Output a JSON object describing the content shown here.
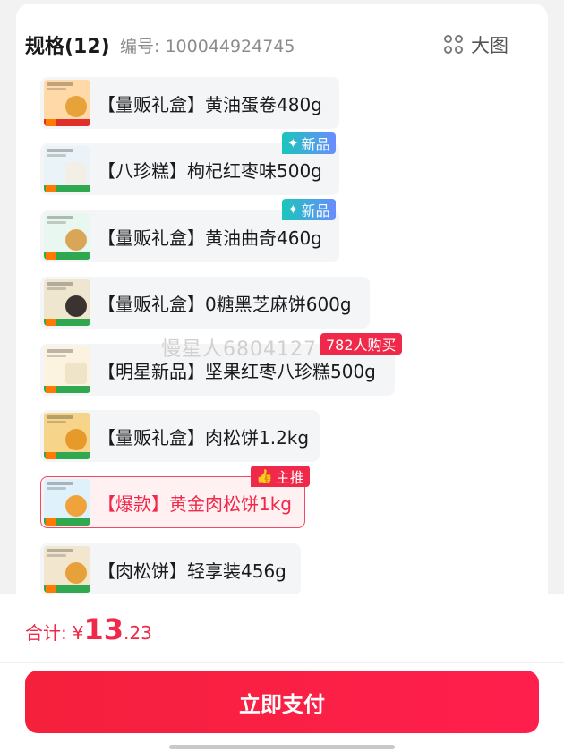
{
  "header": {
    "title": "规格(12)",
    "sku": "编号: 100044924745",
    "big_image_label": "大图"
  },
  "options": [
    {
      "label": "【量贩礼盒】黄油蛋卷480g",
      "selected": false
    },
    {
      "label": "【八珍糕】枸杞红枣味500g",
      "selected": false,
      "tag": "新品"
    },
    {
      "label": "【量贩礼盒】黄油曲奇460g",
      "selected": false,
      "tag": "新品"
    },
    {
      "label": "【量贩礼盒】0糖黑芝麻饼600g",
      "selected": false
    },
    {
      "label": "【明星新品】坚果红枣八珍糕500g",
      "selected": false,
      "tag": "782人购买"
    },
    {
      "label": "【量贩礼盒】肉松饼1.2kg",
      "selected": false
    },
    {
      "label": "【爆款】黄金肉松饼1kg",
      "selected": true,
      "tag": "主推"
    },
    {
      "label": "【肉松饼】轻享装456g",
      "selected": false
    }
  ],
  "watermark": "慢星人6804127",
  "total": {
    "label": "合计:",
    "currency": "¥",
    "integer": "13",
    "decimal": ".23"
  },
  "pay_button": "立即支付",
  "colors": {
    "accent": "#f0284a",
    "new_tag_start": "#19c6bb",
    "new_tag_end": "#6a8cff"
  },
  "icons": {
    "big_image": "grid-four-circles-icon",
    "main_tag": "thumbs-up-icon",
    "new_tag": "sparkle-icon"
  }
}
